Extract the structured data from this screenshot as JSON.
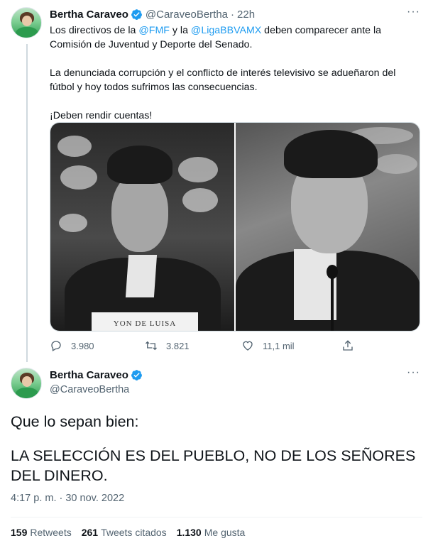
{
  "tweet1": {
    "name": "Bertha Caraveo",
    "handle": "@CaraveoBertha",
    "separator": "·",
    "time": "22h",
    "more_label": "···",
    "paragraph1_pre": "Los directivos de la ",
    "mention1": "@FMF",
    "paragraph1_mid": " y la ",
    "mention2": "@LigaBBVAMX",
    "paragraph1_post": " deben comparecer ante la Comisión de Juventud y Deporte del Senado.",
    "paragraph2": "La denunciada corrupción y el conflicto de interés televisivo se adueñaron del fútbol y hoy todos sufrimos las consecuencias.",
    "paragraph3": "¡Deben rendir cuentas!",
    "photo_left_plate": "YON DE LUISA",
    "replies": "3.980",
    "retweets": "3.821",
    "likes": "11,1 mil",
    "icons": [
      "reply-icon",
      "retweet-icon",
      "like-icon",
      "share-icon",
      "verified-badge-icon"
    ]
  },
  "tweet2": {
    "name": "Bertha Caraveo",
    "handle": "@CaraveoBertha",
    "more_label": "···",
    "line1": "Que lo sepan bien:",
    "line2": "LA SELECCIÓN ES DEL PUEBLO, NO DE LOS SEÑORES DEL DINERO.",
    "timestamp": "4:17 p. m. · 30 nov. 2022",
    "retweets_count": "159",
    "retweets_label": "Retweets",
    "quotes_count": "261",
    "quotes_label": "Tweets citados",
    "likes_count": "1.130",
    "likes_label": "Me gusta"
  },
  "colors": {
    "accent": "#1d9bf0",
    "text": "#0f1419",
    "muted": "#536471",
    "border": "#cfd9de"
  }
}
